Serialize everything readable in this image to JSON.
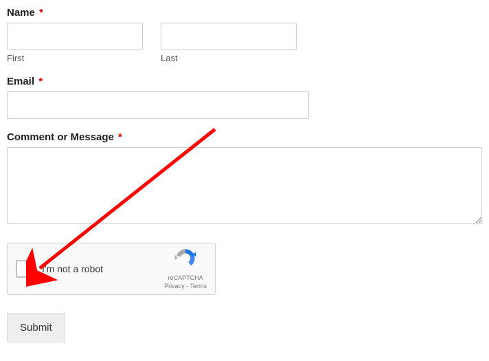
{
  "form": {
    "name": {
      "label": "Name",
      "required_mark": "*",
      "first_label": "First",
      "last_label": "Last",
      "first_value": "",
      "last_value": ""
    },
    "email": {
      "label": "Email",
      "required_mark": "*",
      "value": ""
    },
    "message": {
      "label": "Comment or Message",
      "required_mark": "*",
      "value": ""
    },
    "recaptcha": {
      "checkbox_label": "I'm not a robot",
      "brand": "reCAPTCHA",
      "privacy": "Privacy",
      "separator": " - ",
      "terms": "Terms"
    },
    "submit_label": "Submit"
  },
  "annotation": {
    "arrow_color": "#ff0000"
  }
}
